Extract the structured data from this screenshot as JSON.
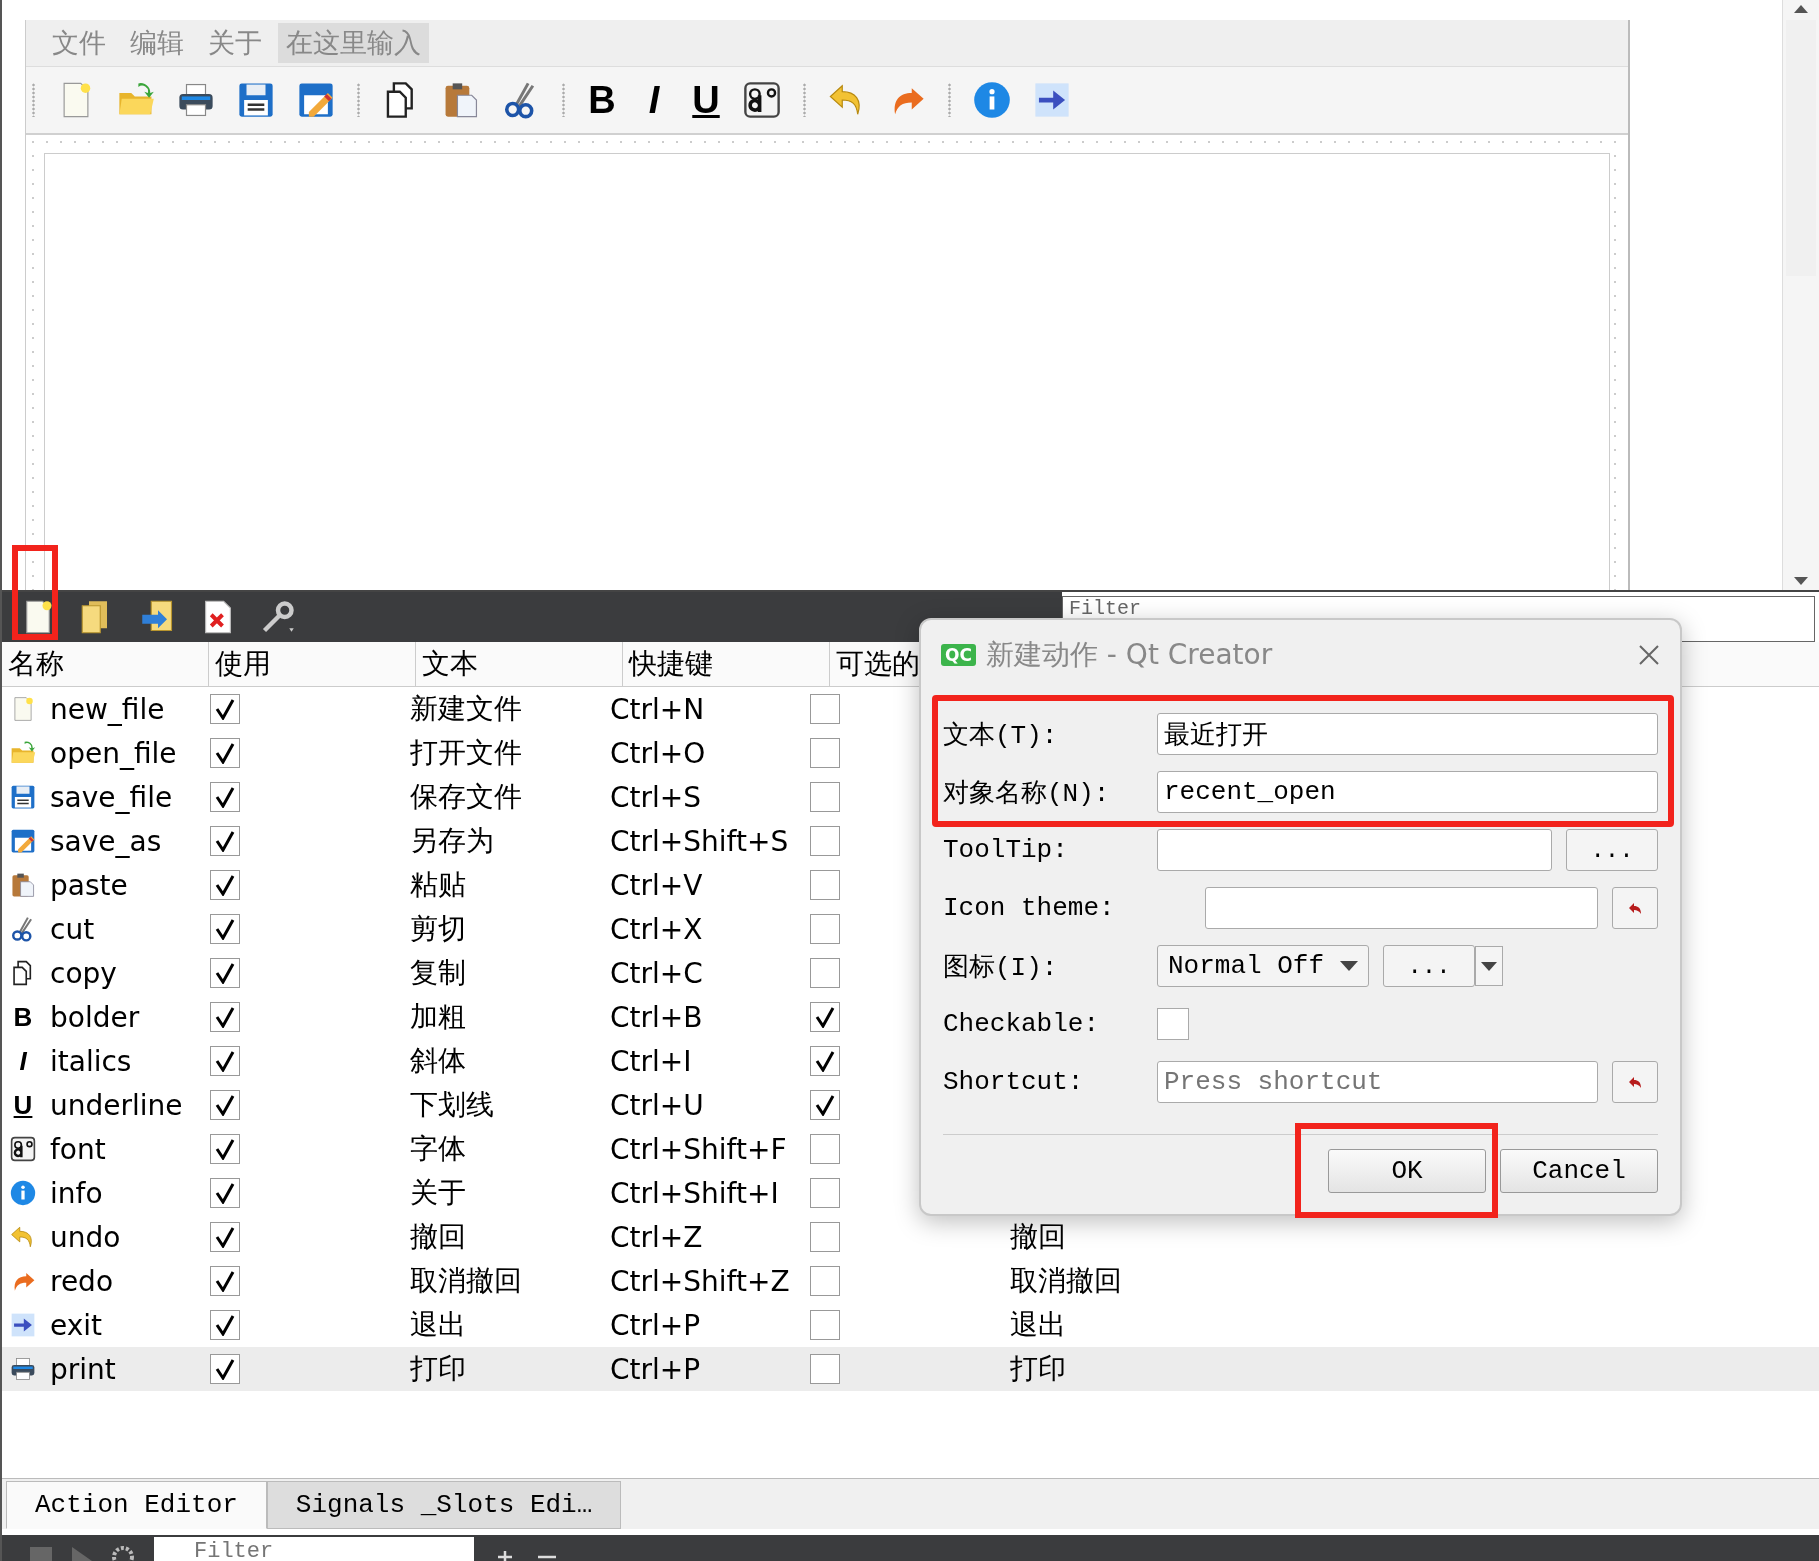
{
  "menu": [
    {
      "label": "文件",
      "selected": false
    },
    {
      "label": "编辑",
      "selected": false
    },
    {
      "label": "关于",
      "selected": false
    },
    {
      "label": "在这里输入",
      "selected": true
    }
  ],
  "toolbar": {
    "format_glyphs": [
      "B",
      "I",
      "U"
    ]
  },
  "action_filter": {
    "placeholder": "Filter"
  },
  "table": {
    "columns": [
      "名称",
      "使用",
      "文本",
      "快捷键",
      "可选的"
    ],
    "rows": [
      {
        "name": "new_file",
        "used": true,
        "text": "新建文件",
        "shortcut": "Ctrl+N",
        "checkable": false,
        "selected": false
      },
      {
        "name": "open_file",
        "used": true,
        "text": "打开文件",
        "shortcut": "Ctrl+O",
        "checkable": false,
        "selected": false
      },
      {
        "name": "save_file",
        "used": true,
        "text": "保存文件",
        "shortcut": "Ctrl+S",
        "checkable": false,
        "selected": false
      },
      {
        "name": "save_as",
        "used": true,
        "text": "另存为",
        "shortcut": "Ctrl+Shift+S",
        "checkable": false,
        "selected": false
      },
      {
        "name": "paste",
        "used": true,
        "text": "粘贴",
        "shortcut": "Ctrl+V",
        "checkable": false,
        "selected": false
      },
      {
        "name": "cut",
        "used": true,
        "text": "剪切",
        "shortcut": "Ctrl+X",
        "checkable": false,
        "selected": false
      },
      {
        "name": "copy",
        "used": true,
        "text": "复制",
        "shortcut": "Ctrl+C",
        "checkable": false,
        "selected": false
      },
      {
        "name": "bolder",
        "used": true,
        "text": "加粗",
        "shortcut": "Ctrl+B",
        "checkable": true,
        "selected": false,
        "icon_glyph": "B"
      },
      {
        "name": "italics",
        "used": true,
        "text": "斜体",
        "shortcut": "Ctrl+I",
        "checkable": true,
        "selected": false,
        "icon_glyph": "I"
      },
      {
        "name": "underline",
        "used": true,
        "text": "下划线",
        "shortcut": "Ctrl+U",
        "checkable": true,
        "selected": false,
        "icon_glyph": "U"
      },
      {
        "name": "font",
        "used": true,
        "text": "字体",
        "shortcut": "Ctrl+Shift+F",
        "checkable": false,
        "selected": false
      },
      {
        "name": "info",
        "used": true,
        "text": "关于",
        "shortcut": "Ctrl+Shift+I",
        "checkable": false,
        "selected": false
      },
      {
        "name": "undo",
        "used": true,
        "text": "撤回",
        "shortcut": "Ctrl+Z",
        "checkable": false,
        "selected": false,
        "column_6": "撤回"
      },
      {
        "name": "redo",
        "used": true,
        "text": "取消撤回",
        "shortcut": "Ctrl+Shift+Z",
        "checkable": false,
        "selected": false,
        "column_6": "取消撤回"
      },
      {
        "name": "exit",
        "used": true,
        "text": "退出",
        "shortcut": "Ctrl+P",
        "checkable": false,
        "selected": false,
        "column_6": "退出"
      },
      {
        "name": "print",
        "used": true,
        "text": "打印",
        "shortcut": "Ctrl+P",
        "checkable": false,
        "selected": true,
        "column_6": "打印"
      }
    ]
  },
  "tabs": [
    {
      "label": "Action Editor",
      "selected": true
    },
    {
      "label": "Signals _Slots Edi…",
      "selected": false
    }
  ],
  "bottom_filter": {
    "placeholder": "Filter"
  },
  "dialog": {
    "app_badge": "QC",
    "title": "新建动作 - Qt Creator",
    "text_label": "文本(T):",
    "text_value": "最近打开",
    "object_label": "对象名称(N):",
    "object_value": "recent_open",
    "tooltip_label": "ToolTip:",
    "tooltip_button": "...",
    "theme_label": "Icon theme:",
    "icon_label": "图标(I):",
    "icon_mode": "Normal Off",
    "icon_button": "...",
    "checkable_label": "Checkable:",
    "checkable": false,
    "shortcut_label": "Shortcut:",
    "shortcut_placeholder": "Press shortcut",
    "buttons": [
      "OK",
      "Cancel"
    ]
  }
}
